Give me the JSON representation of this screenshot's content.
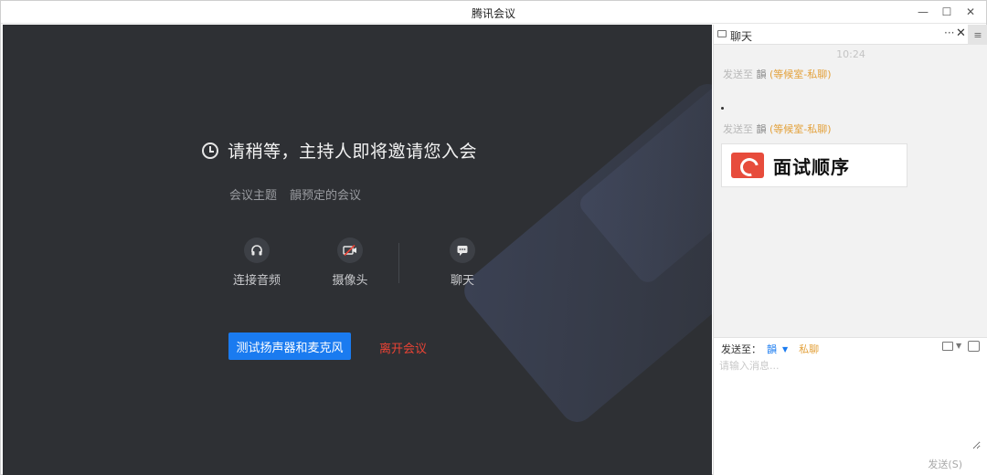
{
  "window": {
    "title": "腾讯会议",
    "min": "—",
    "max": "☐",
    "close": "✕"
  },
  "main": {
    "waiting_text": "请稍等，主持人即将邀请您入会",
    "topic_label": "会议主题",
    "topic_value": "韻预定的会议",
    "actions": [
      {
        "label": "连接音频"
      },
      {
        "label": "摄像头"
      },
      {
        "label": "聊天"
      }
    ],
    "test_button": "测试扬声器和麦克风",
    "leave_button": "离开会议"
  },
  "chat": {
    "title": "聊天",
    "more": "···",
    "close": "✕",
    "menu": "≡",
    "timestamp": "10:24",
    "messages": [
      {
        "prefix": "发送至",
        "name": "韻",
        "tag": "(等候室-私聊)"
      },
      {
        "prefix": "发送至",
        "name": "韻",
        "tag": "(等候室-私聊)"
      }
    ],
    "file_name": "面试顺序",
    "send_to_label": "发送至：",
    "recipient": "韻",
    "private_label": "私聊",
    "input_placeholder": "请输入消息...",
    "send_button": "发送(S)"
  },
  "colors": {
    "accent": "#1a7bf0",
    "leave": "#ea4335",
    "private": "#e3a13b",
    "main_bg": "#2e3034"
  }
}
